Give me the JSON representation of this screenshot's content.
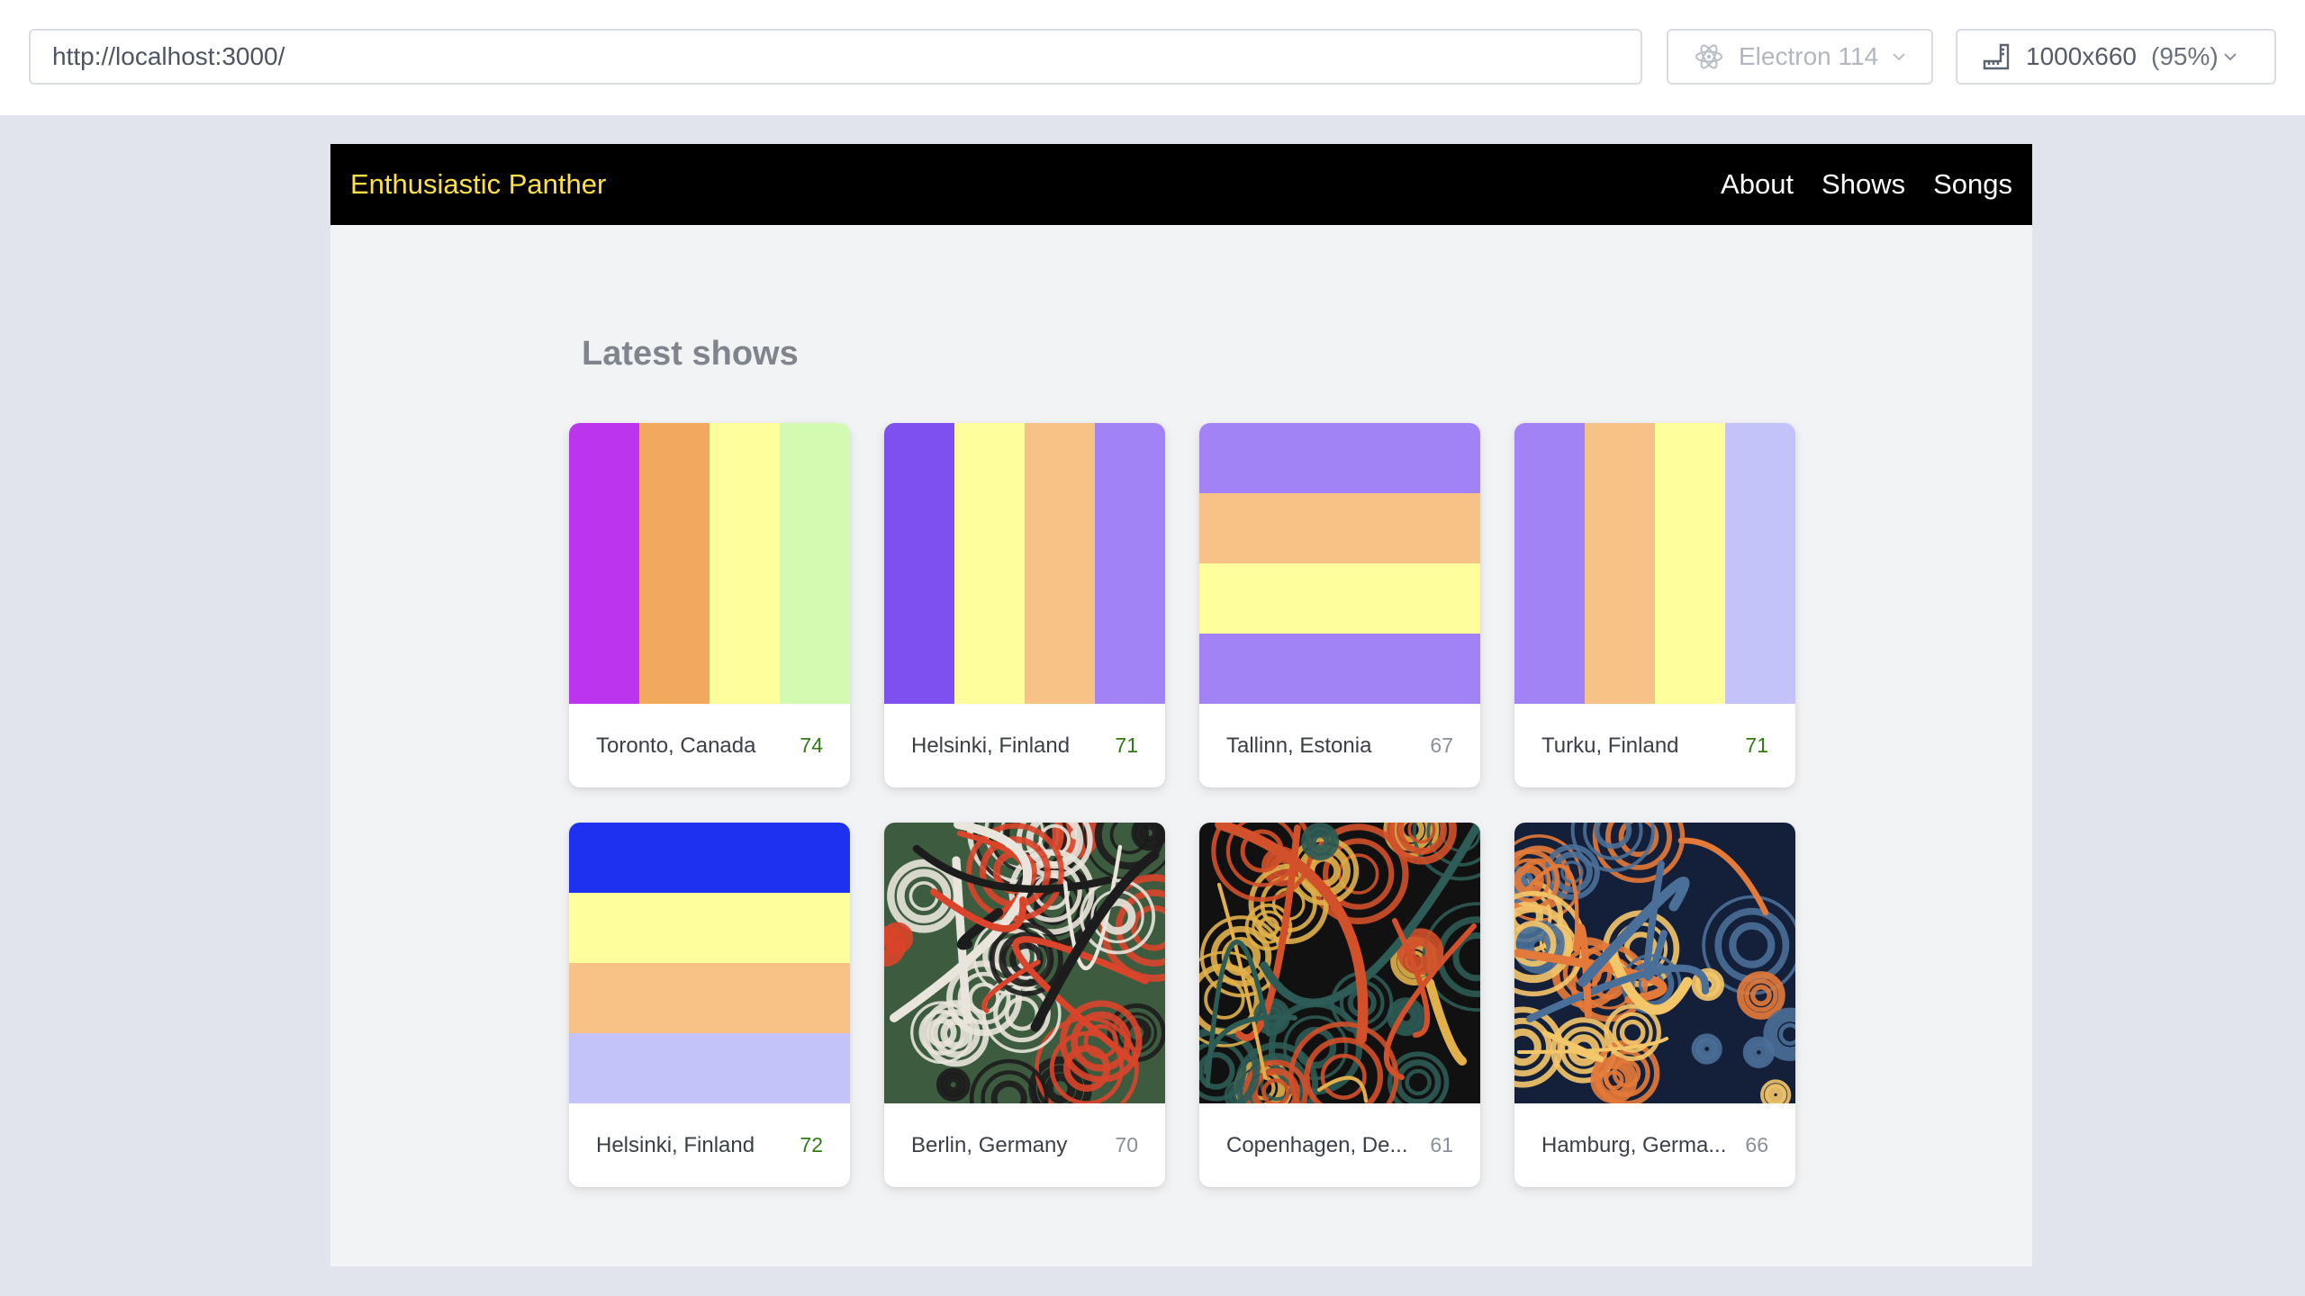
{
  "toolbar": {
    "url": "http://localhost:3000/",
    "engine": {
      "label": "Electron 114",
      "icon": "electron-icon"
    },
    "viewport": {
      "size": "1000x660",
      "zoom": "(95%)",
      "icon": "ruler-icon"
    }
  },
  "nav": {
    "brand": "Enthusiastic Panther",
    "brand_color": "#fde047",
    "links": [
      "About",
      "Shows",
      "Songs"
    ]
  },
  "main": {
    "heading": "Latest shows",
    "shows": [
      {
        "city": "Toronto, Canada",
        "score": "74",
        "art": {
          "kind": "stripes",
          "dir": "v",
          "colors": [
            "#bd34ee",
            "#f2a95e",
            "#fefe9c",
            "#d2fbb1"
          ]
        }
      },
      {
        "city": "Helsinki, Finland",
        "score": "71",
        "art": {
          "kind": "stripes",
          "dir": "v",
          "colors": [
            "#7e50ef",
            "#fefe9c",
            "#f6c285",
            "#a283f5"
          ]
        }
      },
      {
        "city": "Tallinn, Estonia",
        "score": "67",
        "art": {
          "kind": "stripes",
          "dir": "h",
          "colors": [
            "#a283f5",
            "#f6c285",
            "#fefe9c",
            "#a283f5"
          ]
        }
      },
      {
        "city": "Turku, Finland",
        "score": "71",
        "art": {
          "kind": "stripes",
          "dir": "v",
          "colors": [
            "#a283f5",
            "#f6c285",
            "#fefe9c",
            "#c3c3f9"
          ]
        }
      },
      {
        "city": "Helsinki, Finland",
        "score": "72",
        "art": {
          "kind": "stripes",
          "dir": "h",
          "colors": [
            "#1f31f0",
            "#fefe9c",
            "#f6c285",
            "#c3c3f9"
          ]
        }
      },
      {
        "city": "Berlin, Germany",
        "score": "70",
        "art": {
          "kind": "swirl",
          "colors": [
            "#3d5b3e",
            "#d9442a",
            "#e9e4dc",
            "#1c1c1c"
          ]
        }
      },
      {
        "city": "Copenhagen, De...",
        "score": "61",
        "art": {
          "kind": "swirl",
          "colors": [
            "#111111",
            "#d2502a",
            "#e1b04a",
            "#2d5b55"
          ]
        }
      },
      {
        "city": "Hamburg, Germa...",
        "score": "66",
        "art": {
          "kind": "swirl",
          "colors": [
            "#14203a",
            "#e37a3a",
            "#f4c66a",
            "#4a6f98"
          ]
        }
      }
    ],
    "score_colors": {
      "good": "#2f7d12",
      "meh": "#8a8f98"
    }
  }
}
